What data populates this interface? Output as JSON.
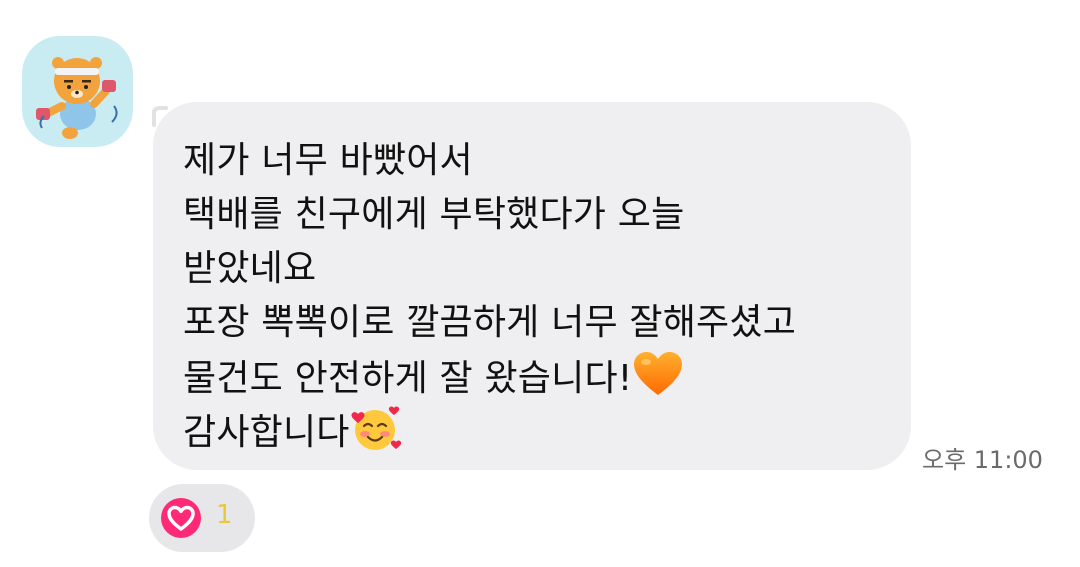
{
  "sender": {
    "avatar_icon": "ryan-bear-exercise-avatar-icon"
  },
  "message": {
    "lines": [
      "제가 너무 바빴어서",
      "택배를 친구에게 부탁했다가 오늘",
      "받았네요",
      "포장 뽁뽁이로 깔끔하게 너무 잘해주셨고",
      "물건도 안전하게 잘 왔습니다!",
      "감사합니다"
    ],
    "emojis": [
      "orange-heart-icon",
      "smiling-face-with-hearts-icon"
    ],
    "timestamp": "오후 11:00"
  },
  "reaction": {
    "icon": "heart-icon",
    "count": "1",
    "color": "#ff2a77"
  },
  "colors": {
    "bubble_background": "#efeff1",
    "avatar_background": "#c9ecf3"
  }
}
